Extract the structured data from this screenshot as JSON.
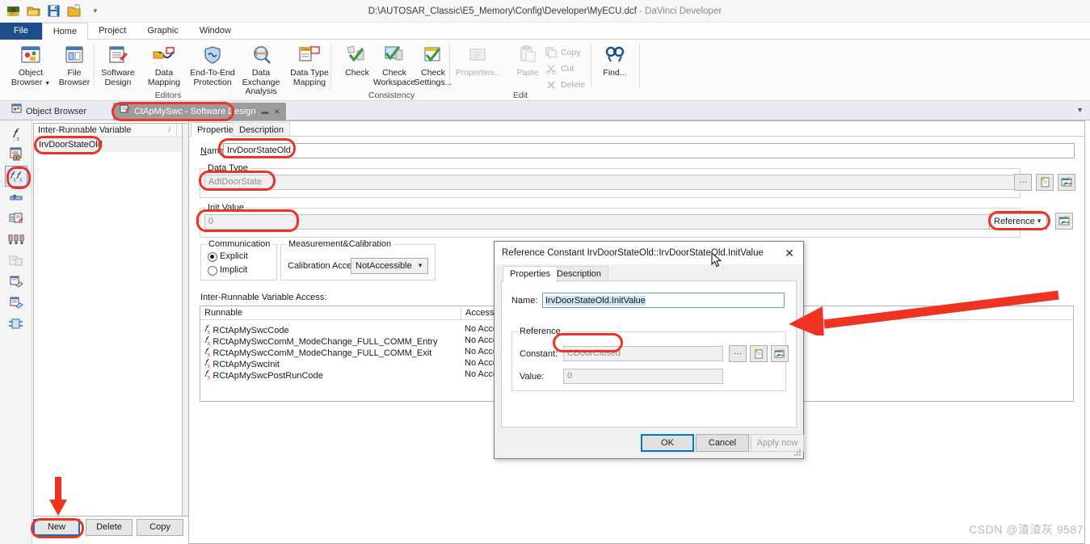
{
  "window": {
    "title_path": "D:\\AUTOSAR_Classic\\E5_Memory\\Config\\Developer\\MyECU.dcf",
    "title_app": " - DaVinci Developer",
    "qat_icons": [
      "app-logo-icon",
      "open-folder-icon",
      "save-icon",
      "open-project-icon",
      "customize-qat-caret"
    ]
  },
  "ribbon": {
    "tabs": [
      {
        "label": "File",
        "kind": "file"
      },
      {
        "label": "Home",
        "kind": "active"
      },
      {
        "label": "Project",
        "kind": "normal"
      },
      {
        "label": "Graphic",
        "kind": "normal"
      },
      {
        "label": "Window",
        "kind": "normal"
      }
    ],
    "groups": [
      {
        "name": "Editors",
        "label": "Editors",
        "buttons": [
          {
            "label": "Object\nBrowser ▾",
            "icon": "object-browser-icon",
            "disabled": false
          },
          {
            "label": "File\nBrowser",
            "icon": "file-browser-icon",
            "disabled": false
          },
          {
            "label": "Software\nDesign",
            "icon": "software-design-icon",
            "disabled": false
          },
          {
            "label": "Data Mapping",
            "icon": "data-mapping-icon",
            "disabled": false
          },
          {
            "label": "End-To-End\nProtection",
            "icon": "end-to-end-protection-icon",
            "disabled": false
          },
          {
            "label": "Data Exchange\nAnalysis",
            "icon": "data-exchange-analysis-icon",
            "disabled": false
          },
          {
            "label": "Data Type\nMapping",
            "icon": "data-type-mapping-icon",
            "disabled": false
          }
        ]
      },
      {
        "name": "Consistency",
        "label": "Consistency",
        "buttons": [
          {
            "label": "Check",
            "icon": "check-icon",
            "disabled": false
          },
          {
            "label": "Check\nWorkspace",
            "icon": "check-workspace-icon",
            "disabled": false
          },
          {
            "label": "Check\nSettings...",
            "icon": "check-settings-icon",
            "disabled": false
          }
        ]
      },
      {
        "name": "Edit",
        "label": "Edit",
        "buttons": [
          {
            "label": "Properties...",
            "icon": "properties-icon",
            "disabled": true
          },
          {
            "label": "Paste",
            "icon": "paste-icon",
            "disabled": true
          },
          {
            "label": "Find...",
            "icon": "find-icon",
            "disabled": false
          }
        ],
        "small_buttons": [
          {
            "label": "Copy",
            "icon": "copy-icon",
            "disabled": true
          },
          {
            "label": "Cut",
            "icon": "cut-icon",
            "disabled": true
          },
          {
            "label": "Delete",
            "icon": "delete-icon",
            "disabled": true
          }
        ]
      }
    ]
  },
  "doctabs": {
    "inactive": {
      "label": "Object Browser",
      "icon": "object-browser-tab-icon"
    },
    "active": {
      "label": "CtApMySwc - Software Design",
      "icon": "software-design-tab-icon",
      "pin": "▬",
      "close": "×"
    },
    "overflow_chevron": "▼"
  },
  "vrail": {
    "items": [
      {
        "name": "port-prototype-icon",
        "selected": false
      },
      {
        "name": "server-call-point-icon",
        "selected": false
      },
      {
        "name": "inter-runnable-variable-icon",
        "selected": true
      },
      {
        "name": "mode-switch-point-icon",
        "selected": false
      },
      {
        "name": "static-memory-icon",
        "selected": false
      },
      {
        "name": "per-instance-memory-icon",
        "selected": false
      },
      {
        "name": "shared-parameter-icon",
        "selected": false
      },
      {
        "name": "exclusive-area-icon",
        "selected": false
      },
      {
        "name": "runnable-entity-icon",
        "selected": false
      },
      {
        "name": "component-ports-icon",
        "selected": false
      }
    ]
  },
  "list_panel": {
    "header": "Inter-Runnable Variable",
    "sort_mark": "/",
    "rows": [
      "IrvDoorStateOld"
    ],
    "buttons": [
      {
        "label": "New",
        "focused": true
      },
      {
        "label": "Delete",
        "focused": false
      },
      {
        "label": "Copy",
        "focused": false
      }
    ]
  },
  "editor": {
    "tabs": [
      {
        "label": "Properties",
        "active": true
      },
      {
        "label": "Description",
        "active": false
      }
    ],
    "name_label": "Name:",
    "name_value": "IrvDoorStateOld",
    "data_type": {
      "caption": "Data Type",
      "value": "AdtDoorState",
      "buttons": [
        "ellipsis-button",
        "new-datatype-button",
        "browse-datatype-button"
      ]
    },
    "init_value": {
      "caption": "Init Value",
      "value": "0",
      "mode": "Reference",
      "browse_button": "browse-init-value-button"
    },
    "communication": {
      "caption": "Communication",
      "options": [
        {
          "label": "Explicit",
          "selected": true
        },
        {
          "label": "Implicit",
          "selected": false
        }
      ]
    },
    "measurement": {
      "caption": "Measurement&Calibration",
      "field_label": "Calibration Access:",
      "field_value": "NotAccessible"
    },
    "access_section_label": "Inter-Runnable Variable Access:",
    "access_table": {
      "columns": [
        "Runnable",
        "Access"
      ],
      "rows": [
        {
          "runnable": "RCtApMySwcCode",
          "access": "No Access"
        },
        {
          "runnable": "RCtApMySwcComM_ModeChange_FULL_COMM_Entry",
          "access": "No Access"
        },
        {
          "runnable": "RCtApMySwcComM_ModeChange_FULL_COMM_Exit",
          "access": "No Access"
        },
        {
          "runnable": "RCtApMySwcInit",
          "access": "No Access"
        },
        {
          "runnable": "RCtApMySwcPostRunCode",
          "access": "No Access"
        }
      ]
    }
  },
  "dialog": {
    "title": "Reference Constant IrvDoorStateOld::IrvDoorStateOld.InitValue",
    "close_label": "✕",
    "tabs": [
      {
        "label": "Properties",
        "active": true
      },
      {
        "label": "Description",
        "active": false
      }
    ],
    "name_label": "Name:",
    "name_value": "IrvDoorStateOld.InitValue",
    "reference_group": {
      "caption": "Reference",
      "constant_label": "Constant:",
      "constant_value": "CDoorClosed",
      "value_label": "Value:",
      "value_value": "0",
      "buttons": [
        "ellipsis-button",
        "new-constant-button",
        "browse-constant-button"
      ]
    },
    "footer_buttons": [
      {
        "label": "OK",
        "state": "primary"
      },
      {
        "label": "Cancel",
        "state": "normal"
      },
      {
        "label": "Apply now",
        "state": "disabled"
      }
    ]
  },
  "watermark": "CSDN @渣渣灰 9587",
  "colors": {
    "annotation": "#ee3322",
    "file_tab": "#1e4d8c",
    "active_doc_tab": "#9c9c9c",
    "focus_blue": "#0078d7"
  }
}
